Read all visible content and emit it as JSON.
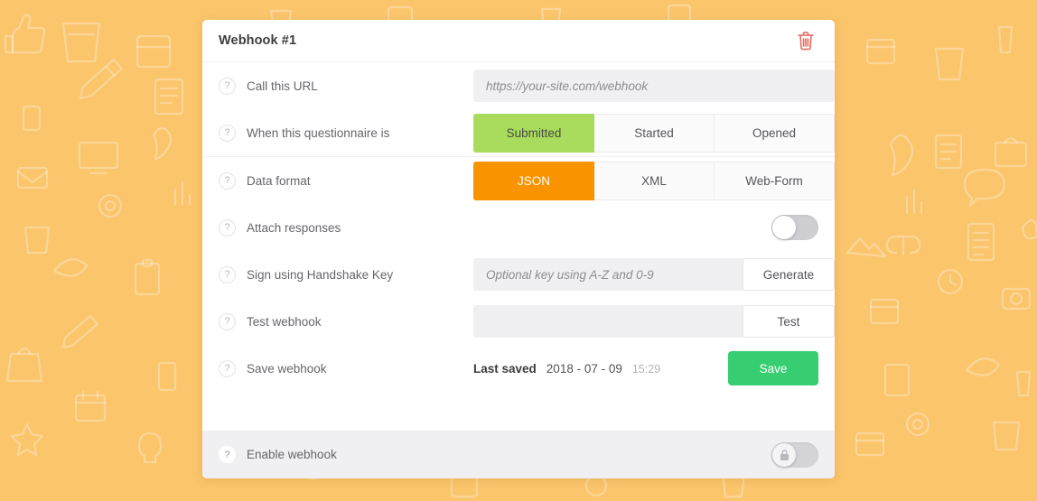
{
  "theme": {
    "page_background": "#FBC56C",
    "card_background": "#FFFFFF",
    "accent_green": "#A9DC5C",
    "accent_orange": "#F99400",
    "save_green": "#36CE70",
    "delete_red": "#E8695E",
    "field_grey": "#F0F0F2"
  },
  "card": {
    "title": "Webhook #1",
    "delete_icon": "trash-icon"
  },
  "rows": {
    "url": {
      "help_icon": "question-mark-icon",
      "label": "Call this URL",
      "input_value": "",
      "input_placeholder": "https://your-site.com/webhook"
    },
    "trigger": {
      "help_icon": "question-mark-icon",
      "label": "When this questionnaire is",
      "options": [
        "Submitted",
        "Started",
        "Opened"
      ],
      "selected": "Submitted"
    },
    "format": {
      "help_icon": "question-mark-icon",
      "label": "Data format",
      "options": [
        "JSON",
        "XML",
        "Web-Form"
      ],
      "selected": "JSON"
    },
    "attach": {
      "help_icon": "question-mark-icon",
      "label": "Attach responses",
      "toggle_state": "off"
    },
    "handshake": {
      "help_icon": "question-mark-icon",
      "label": "Sign using Handshake Key",
      "input_value": "",
      "input_placeholder": "Optional key using A-Z and 0-9",
      "button_label": "Generate"
    },
    "test": {
      "help_icon": "question-mark-icon",
      "label": "Test webhook",
      "input_value": "",
      "input_placeholder": "",
      "button_label": "Test"
    },
    "save": {
      "help_icon": "question-mark-icon",
      "label": "Save webhook",
      "last_saved_label": "Last saved",
      "last_saved_date": "2018 - 07 - 09",
      "last_saved_time": "15:29",
      "button_label": "Save"
    },
    "enable": {
      "help_icon": "question-mark-icon",
      "label": "Enable webhook",
      "toggle_state": "off",
      "knob_icon": "lock-icon"
    }
  }
}
